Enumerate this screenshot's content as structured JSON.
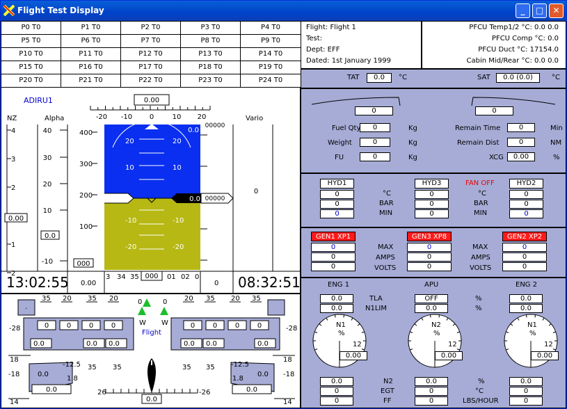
{
  "window": {
    "title": "Flight Test Display"
  },
  "params": [
    "P0 T0",
    "P1 T0",
    "P2 T0",
    "P3 T0",
    "P4 T0",
    "P5 T0",
    "P6 T0",
    "P7 T0",
    "P8 T0",
    "P9 T0",
    "P10 T0",
    "P11 T0",
    "P12 T0",
    "P13 T0",
    "P14 T0",
    "P15 T0",
    "P16 T0",
    "P17 T0",
    "P18 T0",
    "P19 T0",
    "P20 T0",
    "P21 T0",
    "P22 T0",
    "P23 T0",
    "P24 T0"
  ],
  "info": {
    "flight": "Flight:  Flight 1",
    "test": "Test:",
    "dept": "Dept:  EFF",
    "dated": "Dated:  1st January 1999",
    "pfcu_temp": "PFCU Temp1/2 °C:  0.0  0.0",
    "pfcu_comp": "PFCU Comp °C:  0.0",
    "pfcu_duct": "PFCU Duct °C:  17154.0",
    "cabin": "Cabin Mid/Rear °C:  0.0  0.0"
  },
  "temps": {
    "tat_label": "TAT",
    "tat": "0.0",
    "tat_unit": "°C",
    "sat_label": "SAT",
    "sat": "0.0 (0.0)",
    "sat_unit": "°C"
  },
  "fuel": {
    "left_val": "0",
    "right_val": "0",
    "fuel_qty_label": "Fuel Qty",
    "fuel_qty": "0",
    "weight_label": "Weight",
    "weight": "0",
    "fu_label": "FU",
    "fu": "0",
    "kg": "Kg",
    "remain_time_label": "Remain Time",
    "remain_time": "0",
    "min": "Min",
    "remain_dist_label": "Remain Dist",
    "remain_dist": "0",
    "nm": "NM",
    "xcg_label": "XCG",
    "xcg": "0.00",
    "pct": "%"
  },
  "hyd": {
    "hyd1": "HYD1",
    "hyd3": "HYD3",
    "fan_off": "FAN OFF",
    "hyd2": "HYD2",
    "c": "°C",
    "bar": "BAR",
    "min": "MIN",
    "col1": [
      "0",
      "0",
      "0"
    ],
    "col2": [
      "0",
      "0",
      "0"
    ],
    "col3": [
      "0",
      "0",
      "0"
    ]
  },
  "gen": {
    "gen1": "GEN1 XP1",
    "gen3": "GEN3 XP8",
    "gen2": "GEN2 XP2",
    "max": "MAX",
    "amps": "AMPS",
    "volts": "VOLTS",
    "col1": [
      "0",
      "0",
      "0"
    ],
    "col2": [
      "0",
      "0",
      "0"
    ],
    "col3": [
      "0",
      "0",
      "0"
    ]
  },
  "eng": {
    "eng1": "ENG 1",
    "apu": "APU",
    "eng2": "ENG 2",
    "tla": "TLA",
    "n1lim": "N1LIM",
    "pct": "%",
    "e1_tla": "0.0",
    "e1_n1lim": "0.0",
    "apu_tla": "OFF",
    "apu_n1lim": "0.0",
    "e2_tla": "0.0",
    "e2_n1lim": "0.0",
    "n1": "N1",
    "n2_dial": "N2",
    "dial_pct": "%",
    "twelve": "12",
    "e1_dial": "0.00",
    "apu_dial": "0.00",
    "e2_dial": "0.00",
    "n2": "N2",
    "egt": "EGT",
    "ff": "FF",
    "c": "°C",
    "lbs": "LBS/HOUR",
    "e1_bottom": [
      "0.0",
      "0",
      "0"
    ],
    "apu_bottom": [
      "0.0",
      "0",
      "0"
    ],
    "e2_bottom": [
      "0.0",
      "0",
      "0"
    ]
  },
  "pfd": {
    "adiru": "ADIRU1",
    "nz": "NZ",
    "alpha": "Alpha",
    "vario": "Vario",
    "heading_box": "0.00",
    "hdg_scale": [
      "-20",
      "-10",
      "0",
      "10",
      "20"
    ],
    "nz_ticks": [
      "4",
      "3",
      "2",
      "1",
      "1",
      "2"
    ],
    "nz_val": "0.00",
    "alpha_ticks": [
      "40",
      "30",
      "20",
      "10",
      "-10"
    ],
    "alpha_val": "0.0",
    "spd_ticks": [
      "400",
      "300",
      "200",
      "100"
    ],
    "spd_val": "000",
    "pitch": [
      "20",
      "20",
      "10",
      "10",
      "-10",
      "-10",
      "-20",
      "-20"
    ],
    "roll_val": "0.0",
    "alt_val": "00000",
    "alt_roll": "0.0",
    "alt_top": "00000",
    "vario_val": "0",
    "time_left": "13:02:55",
    "bottom_left": "0.00",
    "hdg_tape": [
      "3",
      "34",
      "35",
      "01",
      "02",
      "0"
    ],
    "hdg_val": "000",
    "bottom_right": "0",
    "time_right": "08:32:51"
  },
  "flaps": {
    "top_l": [
      "35",
      "20",
      "35",
      "20"
    ],
    "top_mid": [
      "0",
      "0"
    ],
    "top_r": [
      "20",
      "35",
      "20",
      "35"
    ],
    "w": "W",
    "flight": "Flight",
    "l_side": "-28",
    "r_side": "-28",
    "l_boxes": [
      "0",
      "0",
      "0",
      "0"
    ],
    "r_boxes": [
      "0",
      "0",
      "0",
      "0"
    ],
    "l_row": [
      "0.0",
      "0.0",
      "0.0"
    ],
    "r_row": [
      "0.0",
      "0.0",
      "0.0"
    ],
    "l_18a": "18",
    "l_18b": "-18",
    "r_18a": "18",
    "r_18b": "-18",
    "l_14": "14",
    "r_14": "14",
    "l_el_val": "0.0",
    "l_el_top": "-12.5",
    "l_el_bot": "1.8",
    "l_el_low": "0.0",
    "l_35a": "35",
    "l_35b": "35",
    "r_el_val": "0.0",
    "r_el_top": "-12.5",
    "r_el_bot": "1.8",
    "r_el_low": "0.0",
    "r_35a": "35",
    "r_35b": "35",
    "rudder_l": "26",
    "rudder_r": "-26",
    "rudder_val": "0.0"
  },
  "colors": {
    "sky": "#0a2ff0",
    "ground": "#b7b814",
    "panel": "#a6acd6",
    "gen_red": "#ff1a1a",
    "title_blue": "#0043c8"
  }
}
